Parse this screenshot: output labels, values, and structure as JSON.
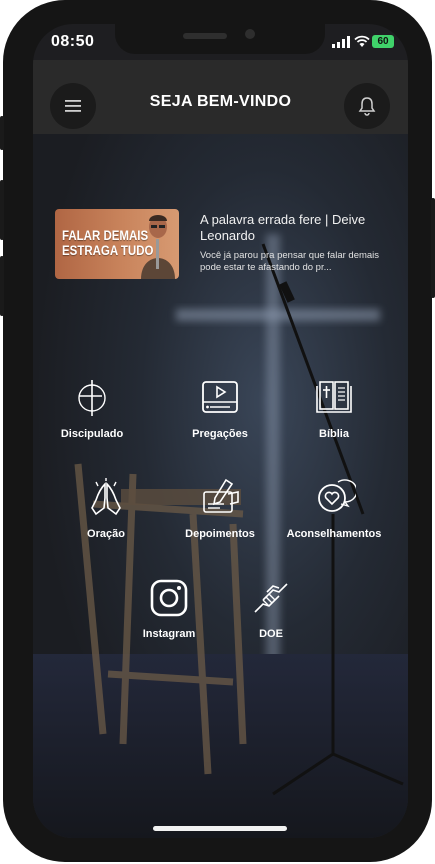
{
  "status": {
    "time": "08:50",
    "battery": "60"
  },
  "header": {
    "title": "SEJA BEM-VINDO",
    "menu_icon": "hamburger-menu-icon",
    "bell_icon": "bell-icon"
  },
  "featured": {
    "thumb_text": "FALAR DEMAIS\nESTRAGA TUDO",
    "title": "A palavra errada fere | Deive Leonardo",
    "description": "Você já parou pra pensar que falar demais pode estar te afastando do pr..."
  },
  "menu": [
    {
      "label": "Discipulado",
      "icon": "cross-circle-icon"
    },
    {
      "label": "Pregações",
      "icon": "video-play-icon"
    },
    {
      "label": "Bíblia",
      "icon": "bible-book-icon"
    },
    {
      "label": "Oração",
      "icon": "praying-hands-icon"
    },
    {
      "label": "Depoimentos",
      "icon": "writing-hand-icon"
    },
    {
      "label": "Aconselhamentos",
      "icon": "heart-chat-icon"
    },
    {
      "label": "Instagram",
      "icon": "instagram-icon"
    },
    {
      "label": "DOE",
      "icon": "handshake-icon"
    }
  ]
}
